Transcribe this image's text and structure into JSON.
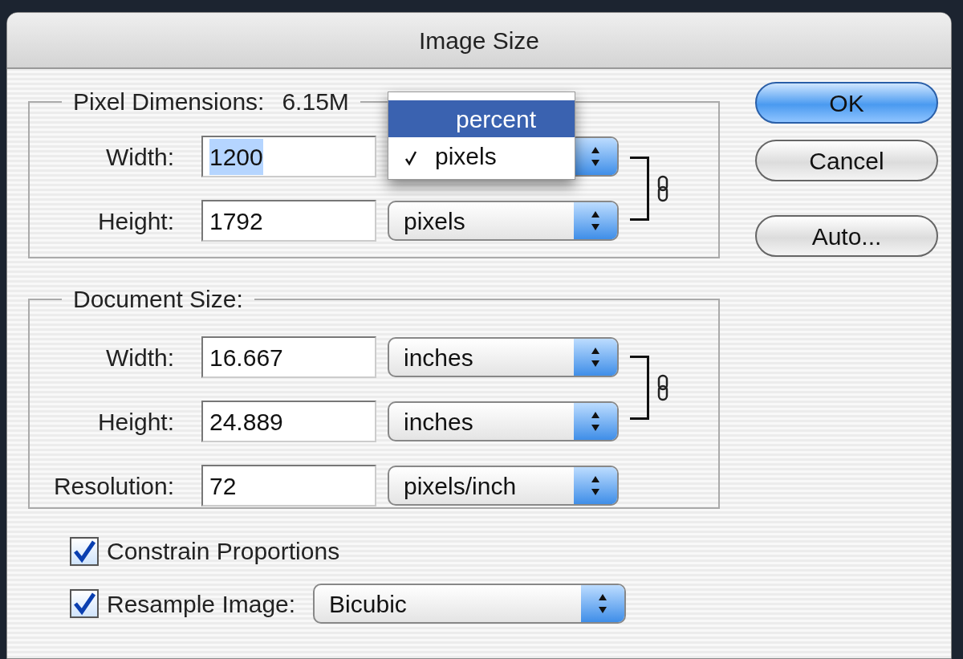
{
  "window": {
    "title": "Image Size"
  },
  "pixel_dimensions": {
    "label": "Pixel Dimensions:",
    "size": "6.15M",
    "rows": [
      {
        "label": "Width:",
        "value": "1200",
        "value_selected": true
      },
      {
        "label": "Height:",
        "value": "1792",
        "unit": "pixels",
        "value_selected": false
      }
    ]
  },
  "unit_menu": {
    "items": [
      {
        "label": "percent",
        "selected": true,
        "checked": false
      },
      {
        "label": "pixels",
        "selected": false,
        "checked": true
      }
    ]
  },
  "document_size": {
    "label": "Document Size:",
    "rows": [
      {
        "label": "Width:",
        "value": "16.667",
        "unit": "inches"
      },
      {
        "label": "Height:",
        "value": "24.889",
        "unit": "inches"
      },
      {
        "label": "Resolution:",
        "value": "72",
        "unit": "pixels/inch"
      }
    ],
    "linked": true
  },
  "options": [
    {
      "label": "Constrain Proportions",
      "checked": true
    },
    {
      "label": "Resample Image:",
      "checked": true,
      "dropdown": "Bicubic"
    }
  ],
  "buttons": [
    {
      "label": "OK",
      "default": true
    },
    {
      "label": "Cancel",
      "default": false
    },
    {
      "label": "Auto...",
      "default": false
    }
  ]
}
